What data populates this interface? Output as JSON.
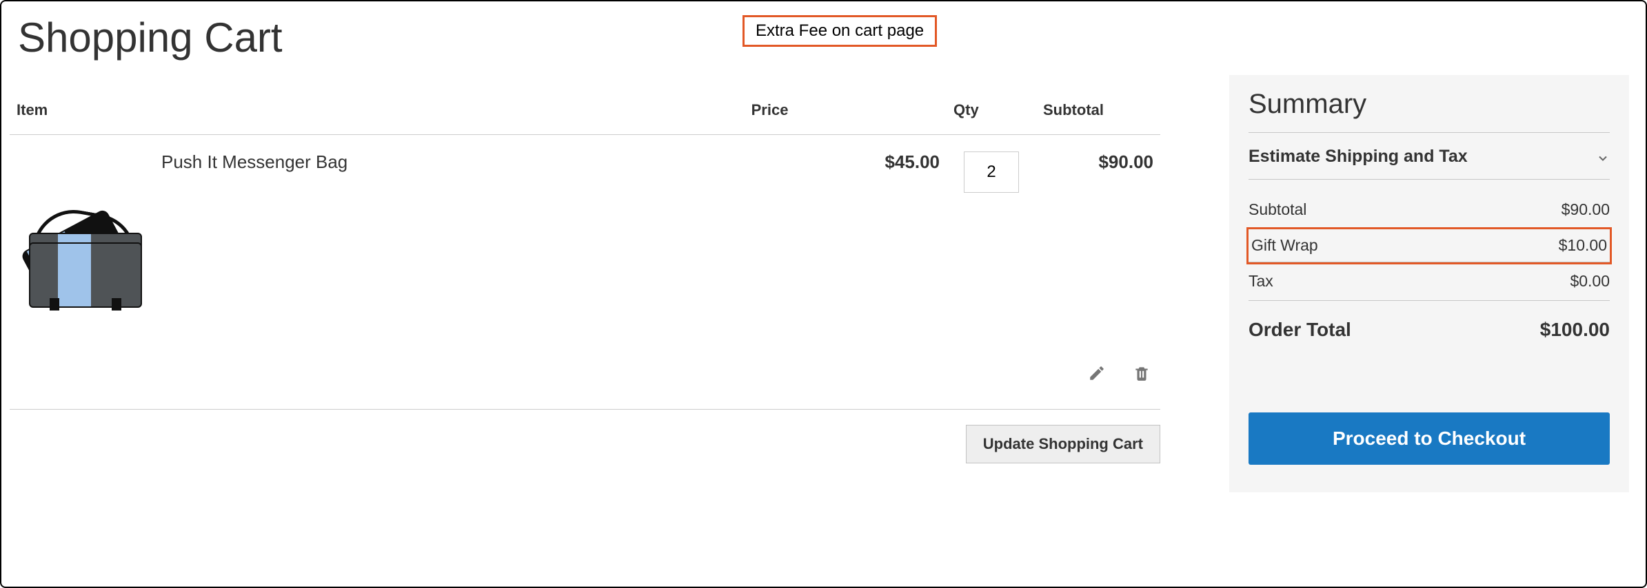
{
  "page": {
    "title": "Shopping Cart",
    "callout": "Extra Fee on cart page"
  },
  "table": {
    "headers": {
      "item": "Item",
      "price": "Price",
      "qty": "Qty",
      "subtotal": "Subtotal"
    }
  },
  "items": [
    {
      "name": "Push It Messenger Bag",
      "price": "$45.00",
      "qty": "2",
      "subtotal": "$90.00"
    }
  ],
  "actions": {
    "update_cart": "Update Shopping Cart"
  },
  "summary": {
    "title": "Summary",
    "estimate": "Estimate Shipping and Tax",
    "lines": {
      "subtotal_label": "Subtotal",
      "subtotal_value": "$90.00",
      "extra_label": "Gift Wrap",
      "extra_value": "$10.00",
      "tax_label": "Tax",
      "tax_value": "$0.00",
      "grand_label": "Order Total",
      "grand_value": "$100.00"
    },
    "checkout": "Proceed to Checkout"
  }
}
